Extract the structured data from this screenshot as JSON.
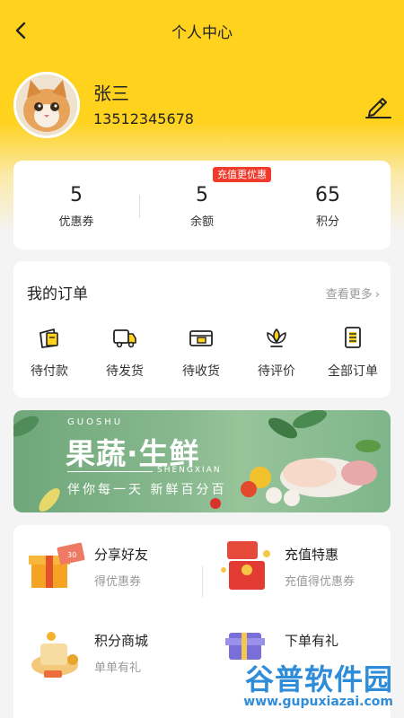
{
  "nav": {
    "title": "个人中心"
  },
  "profile": {
    "name": "张三",
    "phone": "13512345678"
  },
  "stats": {
    "items": [
      {
        "value": "5",
        "label": "优惠券"
      },
      {
        "value": "5",
        "label": "余额"
      },
      {
        "value": "65",
        "label": "积分"
      }
    ],
    "badge": "充值更优惠"
  },
  "orders": {
    "title": "我的订单",
    "see_more": "查看更多",
    "items": [
      {
        "label": "待付款",
        "icon": "wallet-icon"
      },
      {
        "label": "待发货",
        "icon": "truck-icon"
      },
      {
        "label": "待收货",
        "icon": "package-box-icon"
      },
      {
        "label": "待评价",
        "icon": "lotus-icon"
      },
      {
        "label": "全部订单",
        "icon": "list-document-icon"
      }
    ]
  },
  "banner": {
    "en_top": "GUOSHU",
    "title": "果蔬·生鲜",
    "en_bottom": "SHENGXIAN",
    "subtitle": "伴你每一天  新鲜百分百"
  },
  "features": [
    {
      "title": "分享好友",
      "subtitle": "得优惠券",
      "icon": "gift-box-icon"
    },
    {
      "title": "充值特惠",
      "subtitle": "充值得优惠券",
      "icon": "red-envelope-icon"
    },
    {
      "title": "积分商城",
      "subtitle": "单单有礼",
      "icon": "gift-bag-icon"
    },
    {
      "title": "下单有礼",
      "subtitle": "",
      "icon": "shopping-gift-icon"
    }
  ],
  "watermark": {
    "main": "谷普软件园",
    "url": "www.gupuxiazai.com"
  },
  "colors": {
    "brand_yellow": "#ffd21d",
    "badge_red": "#f03a2b",
    "text_gray": "#999999"
  }
}
